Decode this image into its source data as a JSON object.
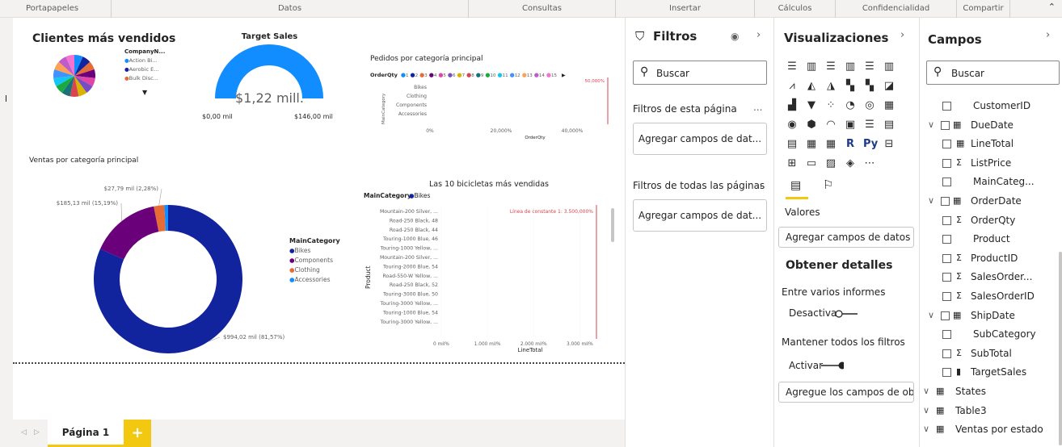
{
  "ribbon": {
    "groups": [
      "Portapapeles",
      "Datos",
      "Consultas",
      "Insertar",
      "Cálculos",
      "Confidencialidad",
      "Compartir"
    ],
    "collapse_icon": "chevron-up-icon"
  },
  "canvas": {
    "customers": {
      "title": "Clientes más vendidos",
      "legend_title": "CompanyN...",
      "legend_items": [
        {
          "label": "Action Bi...",
          "color": "#118dff"
        },
        {
          "label": "Aerobic E...",
          "color": "#12239e"
        },
        {
          "label": "Bulk Disc...",
          "color": "#e66c37"
        }
      ],
      "pie_colors": [
        "#118dff",
        "#12239e",
        "#e66c37",
        "#6b007b",
        "#e044a7",
        "#744ec2",
        "#d9b300",
        "#d64550",
        "#197278",
        "#1aab40",
        "#15c6f4",
        "#4092ff",
        "#ffa058",
        "#be5dc9",
        "#f472d0"
      ]
    },
    "target": {
      "title": "Target Sales",
      "value_label": "$1,22 mill.",
      "min_label": "$0,00 mil",
      "max_label": "$146,00 mil",
      "fill_fraction": 1.0
    },
    "orders": {
      "title": "Pedidos por categoría principal",
      "legend_label": "OrderQty",
      "legend_numbers": [
        "1",
        "2",
        "3",
        "4",
        "5",
        "6",
        "7",
        "8",
        "9",
        "10",
        "11",
        "12",
        "13",
        "14",
        "15"
      ],
      "ylabel": "MainCategory",
      "xlabel": "OrderQty",
      "categories": [
        "Bikes",
        "Clothing",
        "Components",
        "Accessories"
      ],
      "xticks": [
        "0%",
        "20,000%",
        "40,000%"
      ],
      "constant_label": "50,000%"
    },
    "sales_category": {
      "title": "Ventas por categoría principal",
      "legend_title": "MainCategory",
      "labels": [
        "$27,79 mil (2,28%)",
        "$185,13 mil (15,19%)",
        "$994,02 mil (81,57%)"
      ]
    },
    "top_bikes": {
      "title": "Las 10 bicicletas más vendidas",
      "legend_title": "MainCategory",
      "legend_item": "Bikes",
      "ylabel": "Product",
      "xlabel": "LineTotal",
      "constant_label": "Línea de constante 1: 3.500,000%",
      "products": [
        "Mountain-200 Silver, ...",
        "Road-250 Black, 48",
        "Road-250 Black, 44",
        "Touring-1000 Blue, 46",
        "Touring-1000 Yellow, ...",
        "Mountain-200 Silver, ...",
        "Touring-2000 Blue, 54",
        "Road-550-W Yellow, ...",
        "Road-250 Black, 52",
        "Touring-3000 Blue, 50",
        "Touring-3000 Yellow, ...",
        "Touring-1000 Blue, 54",
        "Touring-3000 Yellow, ..."
      ],
      "xticks": [
        "0 mil%",
        "1.000 mil%",
        "2.000 mil%",
        "3.000 mil%"
      ]
    }
  },
  "chart_data": [
    {
      "type": "pie",
      "title": "Ventas por categoría principal",
      "categories": [
        "Bikes",
        "Components",
        "Clothing",
        "Accessories"
      ],
      "values": [
        994.02,
        185.13,
        27.79,
        10.0
      ],
      "colors": [
        "#12239e",
        "#6b007b",
        "#e66c37",
        "#118dff"
      ],
      "legend": "right"
    },
    {
      "type": "bar",
      "title": "Pedidos por categoría principal",
      "categories": [
        "Bikes",
        "Clothing",
        "Components",
        "Accessories"
      ],
      "xlabel": "OrderQty",
      "ylabel": "MainCategory",
      "xlim": [
        0,
        0.5
      ]
    },
    {
      "type": "bar",
      "title": "Las 10 bicicletas más vendidas",
      "xlabel": "LineTotal",
      "ylabel": "Product",
      "xlim": [
        0,
        3500
      ]
    }
  ],
  "tabs": {
    "page_label": "Página 1",
    "add_label": "+",
    "prev_icon": "chevron-left-icon",
    "next_icon": "chevron-right-icon"
  },
  "filters": {
    "title": "Filtros",
    "search_placeholder": "Buscar",
    "page_section": "Filtros de esta página",
    "page_drop": "Agregar campos de dat...",
    "all_section": "Filtros de todas las páginas",
    "all_drop": "Agregar campos de dat...",
    "more": "..."
  },
  "viz": {
    "title": "Visualizaciones",
    "values_label": "Valores",
    "values_drop": "Agregar campos de datos a...",
    "drill_title": "Obtener detalles",
    "cross_report": "Entre varios informes",
    "cross_toggle": "Desactivar",
    "keep_filters": "Mantener todos los filtros",
    "keep_toggle": "Activar",
    "drill_drop": "Agregue los campos de ob...",
    "icons": [
      "stacked-bar-icon",
      "stacked-column-icon",
      "clustered-bar-icon",
      "clustered-column-icon",
      "100-bar-icon",
      "100-column-icon",
      "line-icon",
      "area-icon",
      "stacked-area-icon",
      "line-column-icon",
      "line-clustered-icon",
      "ribbon-icon",
      "waterfall-icon",
      "funnel-icon",
      "scatter-icon",
      "pie-icon",
      "donut-icon",
      "treemap-icon",
      "map-icon",
      "filled-map-icon",
      "gauge-icon",
      "card-icon",
      "multirow-card-icon",
      "kpi-icon",
      "slicer-icon",
      "table-icon",
      "matrix-icon",
      "r-visual-icon",
      "python-visual-icon",
      "key-influencers-icon",
      "decomposition-icon",
      "qa-icon",
      "paginated-icon",
      "custom-visual-icon",
      "more-icon"
    ],
    "icon_glyphs": [
      "☰",
      "▥",
      "☰",
      "▥",
      "☰",
      "▥",
      "⩘",
      "◭",
      "◮",
      "▚",
      "▚",
      "◪",
      "▟",
      "▼",
      "⁘",
      "◔",
      "◎",
      "▦",
      "◉",
      "⬢",
      "◠",
      "▣",
      "☰",
      "▤",
      "▤",
      "▦",
      "▦",
      "R",
      "Py",
      "⊟",
      "⊞",
      "▭",
      "▨",
      "◈",
      "⋯"
    ]
  },
  "fields": {
    "title": "Campos",
    "search_placeholder": "Buscar",
    "items": [
      {
        "name": "CustomerID",
        "expand": false,
        "type": "",
        "indent": 1
      },
      {
        "name": "DueDate",
        "expand": true,
        "type": "▦",
        "indent": 0
      },
      {
        "name": "LineTotal",
        "expand": false,
        "type": "▦",
        "indent": 1
      },
      {
        "name": "ListPrice",
        "expand": false,
        "type": "Σ",
        "indent": 1
      },
      {
        "name": "MainCateg...",
        "expand": false,
        "type": "",
        "indent": 1
      },
      {
        "name": "OrderDate",
        "expand": true,
        "type": "▦",
        "indent": 0
      },
      {
        "name": "OrderQty",
        "expand": false,
        "type": "Σ",
        "indent": 1
      },
      {
        "name": "Product",
        "expand": false,
        "type": "",
        "indent": 1
      },
      {
        "name": "ProductID",
        "expand": false,
        "type": "Σ",
        "indent": 1
      },
      {
        "name": "SalesOrder...",
        "expand": false,
        "type": "Σ",
        "indent": 1
      },
      {
        "name": "SalesOrderID",
        "expand": false,
        "type": "Σ",
        "indent": 1
      },
      {
        "name": "ShipDate",
        "expand": true,
        "type": "▦",
        "indent": 0
      },
      {
        "name": "SubCategory",
        "expand": false,
        "type": "",
        "indent": 1
      },
      {
        "name": "SubTotal",
        "expand": false,
        "type": "Σ",
        "indent": 1
      },
      {
        "name": "TargetSales",
        "expand": false,
        "type": "▮",
        "indent": 1
      }
    ],
    "tables": [
      "States",
      "Table3",
      "Ventas por estado"
    ]
  }
}
